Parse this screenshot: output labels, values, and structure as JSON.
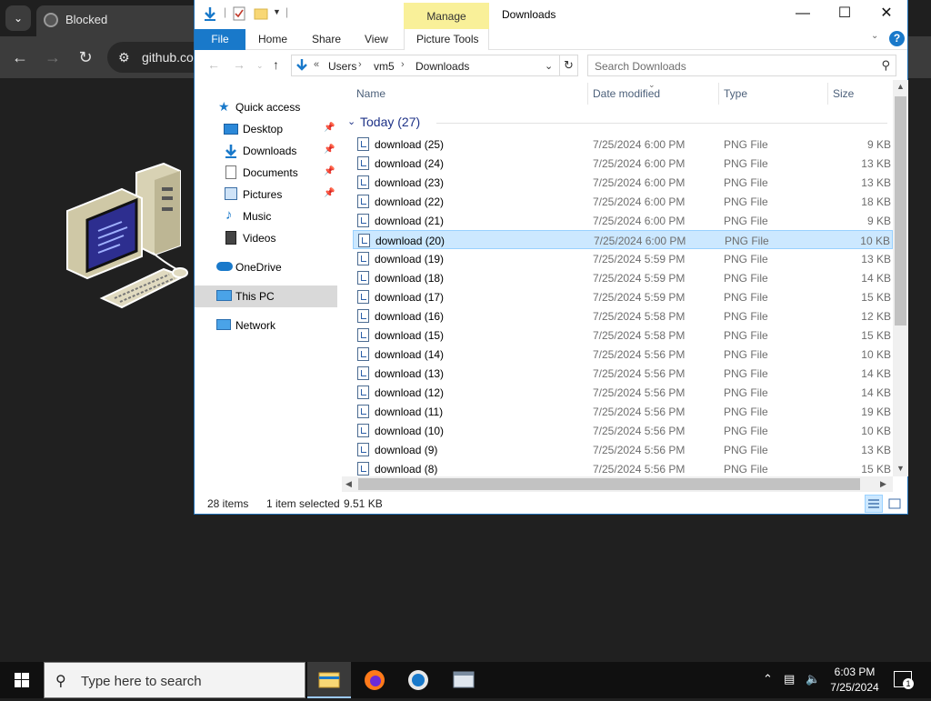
{
  "browser": {
    "tab_title": "Blocked",
    "omnibox_text": "github.co"
  },
  "explorer": {
    "title": "Downloads",
    "manage_label": "Manage",
    "ribbon_tabs": {
      "file": "File",
      "home": "Home",
      "share": "Share",
      "view": "View",
      "picture_tools": "Picture Tools"
    },
    "address": {
      "prefix": "«",
      "crumbs": [
        "Users",
        "vm5",
        "Downloads"
      ]
    },
    "search_placeholder": "Search Downloads",
    "nav": {
      "quick_access": "Quick access",
      "desktop": "Desktop",
      "downloads": "Downloads",
      "documents": "Documents",
      "pictures": "Pictures",
      "music": "Music",
      "videos": "Videos",
      "onedrive": "OneDrive",
      "this_pc": "This PC",
      "network": "Network"
    },
    "columns": {
      "name": "Name",
      "date": "Date modified",
      "type": "Type",
      "size": "Size"
    },
    "group_label": "Today (27)",
    "files": [
      {
        "name": "download (25)",
        "date": "7/25/2024 6:00 PM",
        "type": "PNG File",
        "size": "9 KB"
      },
      {
        "name": "download (24)",
        "date": "7/25/2024 6:00 PM",
        "type": "PNG File",
        "size": "13 KB"
      },
      {
        "name": "download (23)",
        "date": "7/25/2024 6:00 PM",
        "type": "PNG File",
        "size": "13 KB"
      },
      {
        "name": "download (22)",
        "date": "7/25/2024 6:00 PM",
        "type": "PNG File",
        "size": "18 KB"
      },
      {
        "name": "download (21)",
        "date": "7/25/2024 6:00 PM",
        "type": "PNG File",
        "size": "9 KB"
      },
      {
        "name": "download (20)",
        "date": "7/25/2024 6:00 PM",
        "type": "PNG File",
        "size": "10 KB"
      },
      {
        "name": "download (19)",
        "date": "7/25/2024 5:59 PM",
        "type": "PNG File",
        "size": "13 KB"
      },
      {
        "name": "download (18)",
        "date": "7/25/2024 5:59 PM",
        "type": "PNG File",
        "size": "14 KB"
      },
      {
        "name": "download (17)",
        "date": "7/25/2024 5:59 PM",
        "type": "PNG File",
        "size": "15 KB"
      },
      {
        "name": "download (16)",
        "date": "7/25/2024 5:58 PM",
        "type": "PNG File",
        "size": "12 KB"
      },
      {
        "name": "download (15)",
        "date": "7/25/2024 5:58 PM",
        "type": "PNG File",
        "size": "15 KB"
      },
      {
        "name": "download (14)",
        "date": "7/25/2024 5:56 PM",
        "type": "PNG File",
        "size": "10 KB"
      },
      {
        "name": "download (13)",
        "date": "7/25/2024 5:56 PM",
        "type": "PNG File",
        "size": "14 KB"
      },
      {
        "name": "download (12)",
        "date": "7/25/2024 5:56 PM",
        "type": "PNG File",
        "size": "14 KB"
      },
      {
        "name": "download (11)",
        "date": "7/25/2024 5:56 PM",
        "type": "PNG File",
        "size": "19 KB"
      },
      {
        "name": "download (10)",
        "date": "7/25/2024 5:56 PM",
        "type": "PNG File",
        "size": "10 KB"
      },
      {
        "name": "download (9)",
        "date": "7/25/2024 5:56 PM",
        "type": "PNG File",
        "size": "13 KB"
      },
      {
        "name": "download (8)",
        "date": "7/25/2024 5:56 PM",
        "type": "PNG File",
        "size": "15 KB"
      }
    ],
    "status": {
      "items": "28 items",
      "selected": "1 item selected",
      "size": "9.51 KB"
    }
  },
  "taskbar": {
    "search_placeholder": "Type here to search",
    "time": "6:03 PM",
    "date": "7/25/2024",
    "notification_count": "1"
  },
  "colors": {
    "accent": "#1979ca",
    "selection": "#cce8ff",
    "manage_tab": "#f9f099"
  }
}
